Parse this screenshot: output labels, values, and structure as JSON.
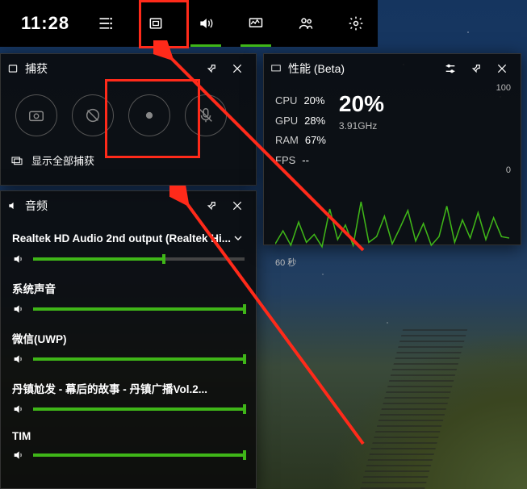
{
  "topbar": {
    "time": "11:28"
  },
  "capture": {
    "title": "捕获",
    "footer": "显示全部捕获"
  },
  "audio": {
    "title": "音频",
    "device": "Realtek HD Audio 2nd output (Realtek Hi...",
    "items": [
      {
        "label": "",
        "fill": 62
      },
      {
        "label": "系统声音",
        "fill": 100
      },
      {
        "label": "微信(UWP)",
        "fill": 100
      },
      {
        "label": "丹镇尬发 - 幕后的故事 - 丹镇广播Vol.2...",
        "fill": 100
      },
      {
        "label": "TIM",
        "fill": 100
      }
    ]
  },
  "perf": {
    "title": "性能 (Beta)",
    "cpu_lbl": "CPU",
    "cpu_val": "20%",
    "gpu_lbl": "GPU",
    "gpu_val": "28%",
    "ram_lbl": "RAM",
    "ram_val": "67%",
    "fps_lbl": "FPS",
    "fps_val": "--",
    "big_pct": "20%",
    "freq": "3.91GHz",
    "ymax": "100",
    "ymin": "0",
    "xlabel": "60 秒"
  },
  "chart_data": {
    "type": "line",
    "title": "CPU usage over 60s",
    "xlabel": "60 秒",
    "ylabel": "",
    "ylim": [
      0,
      100
    ],
    "x": [
      0,
      2,
      4,
      6,
      8,
      10,
      12,
      14,
      16,
      18,
      20,
      22,
      24,
      26,
      28,
      30,
      32,
      34,
      36,
      38,
      40,
      42,
      44,
      46,
      48,
      50,
      52,
      54,
      56,
      58,
      60
    ],
    "series": [
      {
        "name": "CPU",
        "values": [
          12,
          30,
          10,
          42,
          14,
          25,
          8,
          60,
          18,
          38,
          10,
          70,
          14,
          22,
          50,
          12,
          34,
          58,
          16,
          40,
          10,
          22,
          64,
          14,
          45,
          20,
          55,
          18,
          48,
          22,
          20
        ]
      }
    ]
  }
}
